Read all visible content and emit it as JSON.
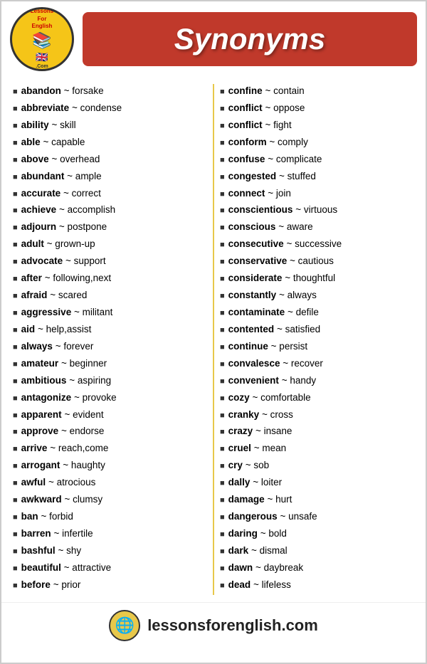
{
  "header": {
    "logo_top": "LessonsForEnglish",
    "logo_com": ".Com",
    "title": "Synonyms"
  },
  "left_column": [
    {
      "word": "abandon",
      "synonym": "forsake"
    },
    {
      "word": "abbreviate",
      "synonym": "condense"
    },
    {
      "word": "ability",
      "synonym": "skill"
    },
    {
      "word": "able",
      "synonym": "capable"
    },
    {
      "word": "above",
      "synonym": "overhead"
    },
    {
      "word": "abundant",
      "synonym": "ample"
    },
    {
      "word": "accurate",
      "synonym": "correct"
    },
    {
      "word": "achieve",
      "synonym": "accomplish"
    },
    {
      "word": "adjourn",
      "synonym": "postpone"
    },
    {
      "word": "adult",
      "synonym": "grown-up"
    },
    {
      "word": "advocate",
      "synonym": "support"
    },
    {
      "word": "after",
      "synonym": "following,next"
    },
    {
      "word": "afraid",
      "synonym": "scared"
    },
    {
      "word": "aggressive",
      "synonym": "militant"
    },
    {
      "word": "aid",
      "synonym": "help,assist"
    },
    {
      "word": "always",
      "synonym": "forever"
    },
    {
      "word": "amateur",
      "synonym": "beginner"
    },
    {
      "word": "ambitious",
      "synonym": "aspiring"
    },
    {
      "word": "antagonize",
      "synonym": "provoke"
    },
    {
      "word": "apparent",
      "synonym": "evident"
    },
    {
      "word": "approve",
      "synonym": "endorse"
    },
    {
      "word": "arrive",
      "synonym": "reach,come"
    },
    {
      "word": "arrogant",
      "synonym": "haughty"
    },
    {
      "word": "awful",
      "synonym": "atrocious"
    },
    {
      "word": "awkward",
      "synonym": "clumsy"
    },
    {
      "word": "ban",
      "synonym": "forbid"
    },
    {
      "word": "barren",
      "synonym": "infertile"
    },
    {
      "word": "bashful",
      "synonym": "shy"
    },
    {
      "word": "beautiful",
      "synonym": "attractive"
    },
    {
      "word": "before",
      "synonym": "prior"
    }
  ],
  "right_column": [
    {
      "word": "confine",
      "synonym": "contain"
    },
    {
      "word": "conflict",
      "synonym": "oppose"
    },
    {
      "word": "conflict",
      "synonym": "fight"
    },
    {
      "word": "conform",
      "synonym": "comply"
    },
    {
      "word": "confuse",
      "synonym": "complicate"
    },
    {
      "word": "congested",
      "synonym": "stuffed"
    },
    {
      "word": "connect",
      "synonym": "join"
    },
    {
      "word": "conscientious",
      "synonym": "virtuous"
    },
    {
      "word": "conscious",
      "synonym": "aware"
    },
    {
      "word": "consecutive",
      "synonym": "successive"
    },
    {
      "word": "conservative",
      "synonym": "cautious"
    },
    {
      "word": "considerate",
      "synonym": "thoughtful"
    },
    {
      "word": "constantly",
      "synonym": "always"
    },
    {
      "word": "contaminate",
      "synonym": "defile"
    },
    {
      "word": "contented",
      "synonym": "satisfied"
    },
    {
      "word": "continue",
      "synonym": "persist"
    },
    {
      "word": "convalesce",
      "synonym": "recover"
    },
    {
      "word": "convenient",
      "synonym": "handy"
    },
    {
      "word": "cozy",
      "synonym": "comfortable"
    },
    {
      "word": "cranky",
      "synonym": "cross"
    },
    {
      "word": "crazy",
      "synonym": "insane"
    },
    {
      "word": "cruel",
      "synonym": "mean"
    },
    {
      "word": "cry",
      "synonym": "sob"
    },
    {
      "word": "dally",
      "synonym": "loiter"
    },
    {
      "word": "damage",
      "synonym": "hurt"
    },
    {
      "word": "dangerous",
      "synonym": "unsafe"
    },
    {
      "word": "daring",
      "synonym": "bold"
    },
    {
      "word": "dark",
      "synonym": "dismal"
    },
    {
      "word": "dawn",
      "synonym": "daybreak"
    },
    {
      "word": "dead",
      "synonym": "lifeless"
    }
  ],
  "footer": {
    "url": "lessonsforenglish.com"
  }
}
